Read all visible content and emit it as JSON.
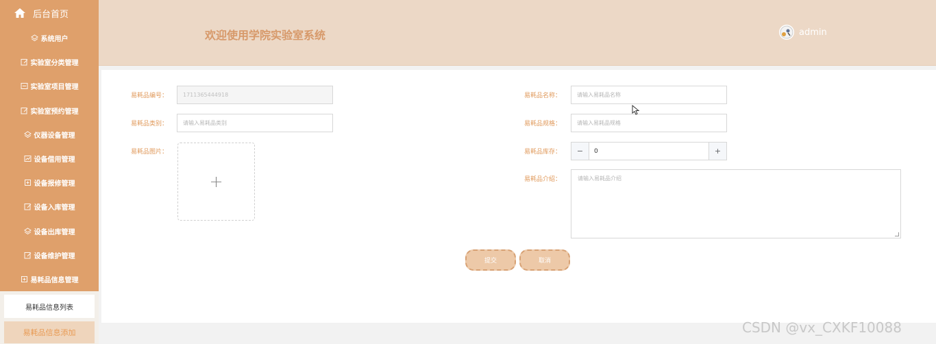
{
  "sidebar": {
    "home": {
      "label": "后台首页",
      "icon": "home-icon"
    },
    "items": [
      {
        "label": "系统用户",
        "icon": "layers-icon"
      },
      {
        "label": "实验室分类管理",
        "icon": "edit-icon"
      },
      {
        "label": "实验室项目管理",
        "icon": "list-icon"
      },
      {
        "label": "实验室预约管理",
        "icon": "edit-icon"
      },
      {
        "label": "仪器设备管理",
        "icon": "layers-icon"
      },
      {
        "label": "设备借用管理",
        "icon": "chart-icon"
      },
      {
        "label": "设备报修管理",
        "icon": "doc-icon"
      },
      {
        "label": "设备入库管理",
        "icon": "edit-icon"
      },
      {
        "label": "设备出库管理",
        "icon": "layers-icon"
      },
      {
        "label": "设备维护管理",
        "icon": "edit-icon"
      },
      {
        "label": "易耗品信息管理",
        "icon": "doc-icon"
      }
    ],
    "sub": [
      {
        "label": "易耗品信息列表"
      },
      {
        "label": "易耗品信息添加"
      }
    ]
  },
  "header": {
    "title": "欢迎使用学院实验室系统",
    "user": "admin"
  },
  "form": {
    "code_label": "易耗品编号：",
    "code_value": "1711365444918",
    "name_label": "易耗品名称：",
    "name_placeholder": "请输入易耗品名称",
    "category_label": "易耗品类别：",
    "category_placeholder": "请输入易耗品类别",
    "spec_label": "易耗品规格：",
    "spec_placeholder": "请输入易耗品规格",
    "image_label": "易耗品图片：",
    "upload_symbol": "+",
    "stock_label": "易耗品库存：",
    "stock_value": "0",
    "stock_minus": "−",
    "stock_plus": "+",
    "intro_label": "易耗品介绍：",
    "intro_placeholder": "请输入易耗品介绍",
    "submit": "提交",
    "cancel": "取消"
  },
  "watermark": "CSDN @vx_CXKF10088",
  "colors": {
    "sidebar": "#dfa06b",
    "header": "#ecd8c6",
    "accent": "#e09a5c"
  }
}
